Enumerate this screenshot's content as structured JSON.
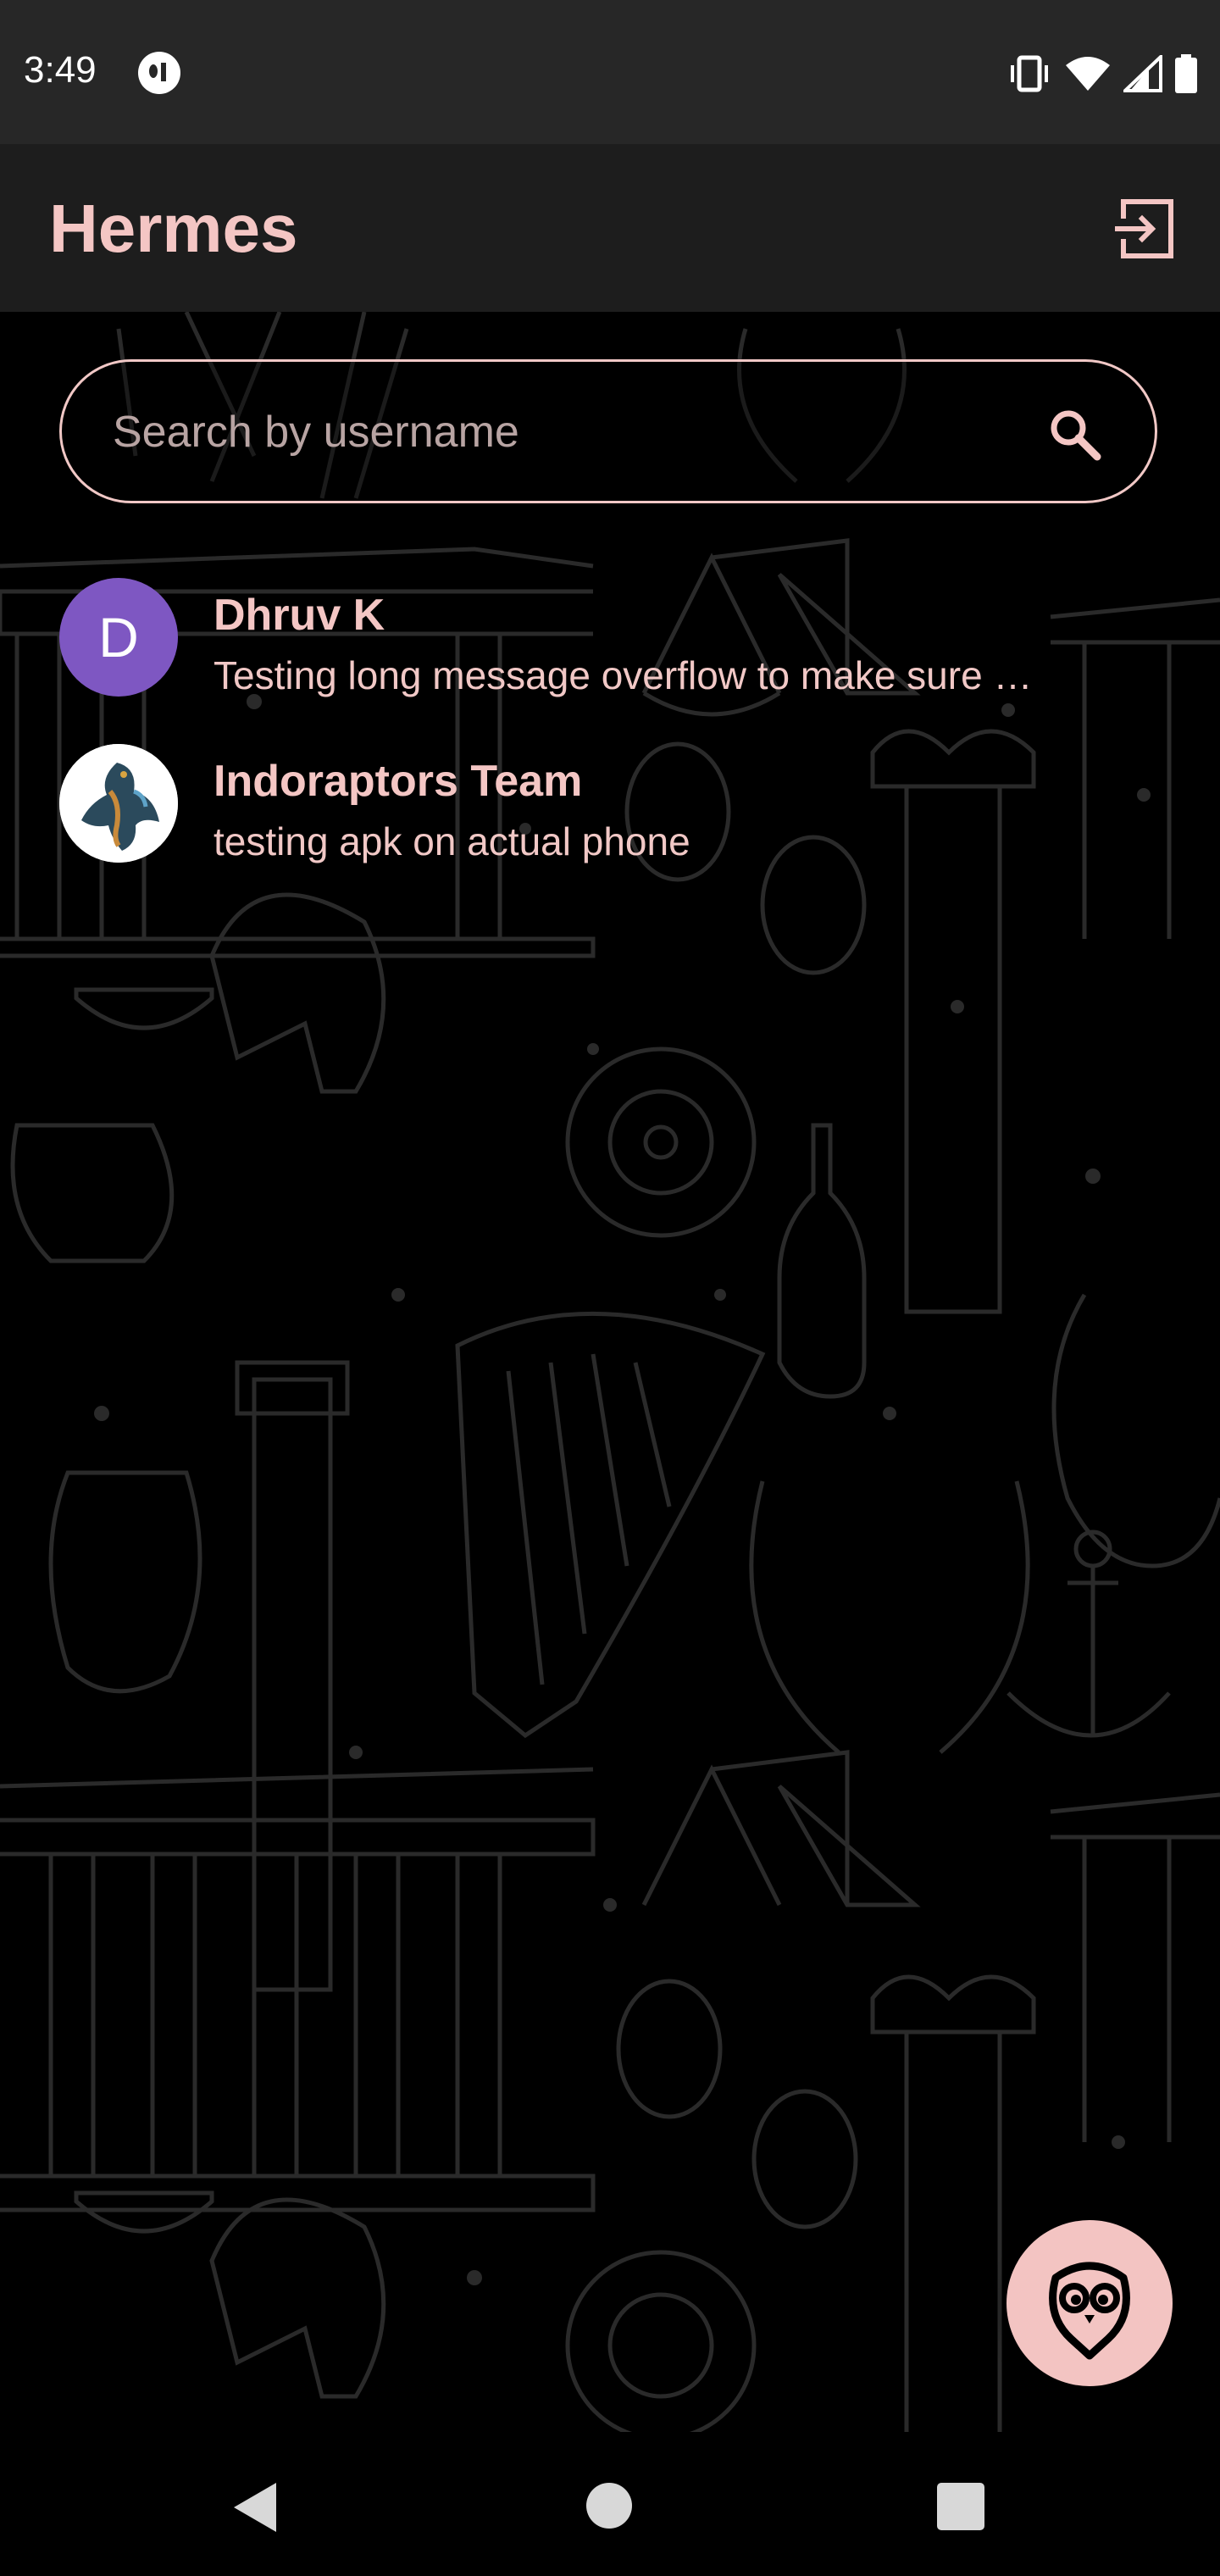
{
  "status_bar": {
    "time": "3:49",
    "icons": [
      "vibrate-icon",
      "wifi-icon",
      "signal-icon",
      "battery-icon"
    ]
  },
  "app_bar": {
    "title": "Hermes",
    "logout_icon": "logout-icon"
  },
  "search": {
    "placeholder": "Search by username",
    "value": "",
    "icon": "search-icon"
  },
  "chats": [
    {
      "avatar_letter": "D",
      "name": "Dhruv K",
      "last_message": "Testing long message overflow to make sure …"
    },
    {
      "avatar_letter": "",
      "name": "Indoraptors Team",
      "last_message": "testing apk on actual phone"
    }
  ],
  "fab": {
    "icon": "owl-icon"
  },
  "nav_bar": {
    "icons": [
      "back-icon",
      "home-icon",
      "recents-icon"
    ]
  },
  "colors": {
    "accent": "#f4c6c4",
    "avatar_purple": "#7e57c2",
    "app_bar_bg": "#1d1d1d",
    "status_bar_bg": "#272727",
    "background": "#000000"
  }
}
